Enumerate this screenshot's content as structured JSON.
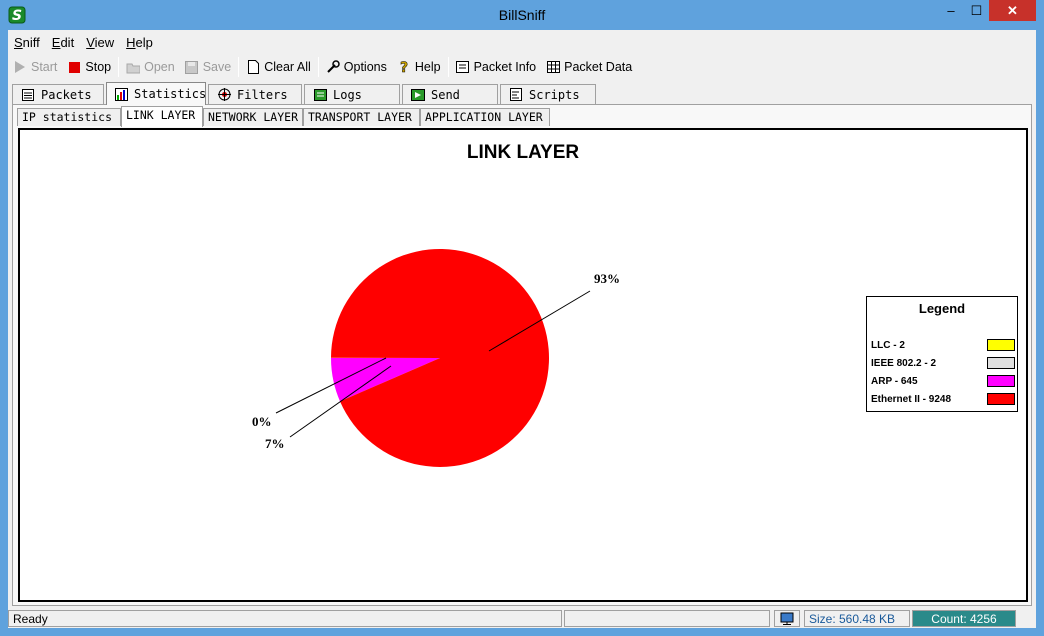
{
  "window": {
    "title": "BillSniff",
    "min": "–",
    "max": "☐",
    "close": "✕"
  },
  "menu": [
    {
      "mnemonic": "S",
      "rest": "niff"
    },
    {
      "mnemonic": "E",
      "rest": "dit"
    },
    {
      "mnemonic": "V",
      "rest": "iew"
    },
    {
      "mnemonic": "H",
      "rest": "elp"
    }
  ],
  "toolbar": {
    "start": "Start",
    "stop": "Stop",
    "open": "Open",
    "save": "Save",
    "clear_all": "Clear All",
    "options": "Options",
    "help": "Help",
    "packet_info": "Packet Info",
    "packet_data": "Packet Data"
  },
  "tabs": [
    "Packets",
    "Statistics",
    "Filters",
    "Logs",
    "Send",
    "Scripts"
  ],
  "subtabs": [
    "IP statistics",
    "LINK LAYER",
    "NETWORK LAYER",
    "TRANSPORT LAYER",
    "APPLICATION LAYER"
  ],
  "chart_data": {
    "type": "pie",
    "title": "LINK LAYER",
    "legend_title": "Legend",
    "legend_position": "right",
    "slices": [
      {
        "label": "LLC - 2",
        "value": 2,
        "color": "#ffff00"
      },
      {
        "label": "IEEE 802.2 - 2",
        "value": 2,
        "color": "#e0e0e0"
      },
      {
        "label": "ARP - 645",
        "value": 645,
        "color": "#ff00ff"
      },
      {
        "label": "Ethernet II - 9248",
        "value": 9248,
        "color": "#ff0000"
      }
    ],
    "percent_labels": [
      "93%",
      "0%",
      "7%"
    ]
  },
  "status": {
    "text": "Ready",
    "size": "Size: 560.48 KB",
    "count": "Count: 4256"
  }
}
